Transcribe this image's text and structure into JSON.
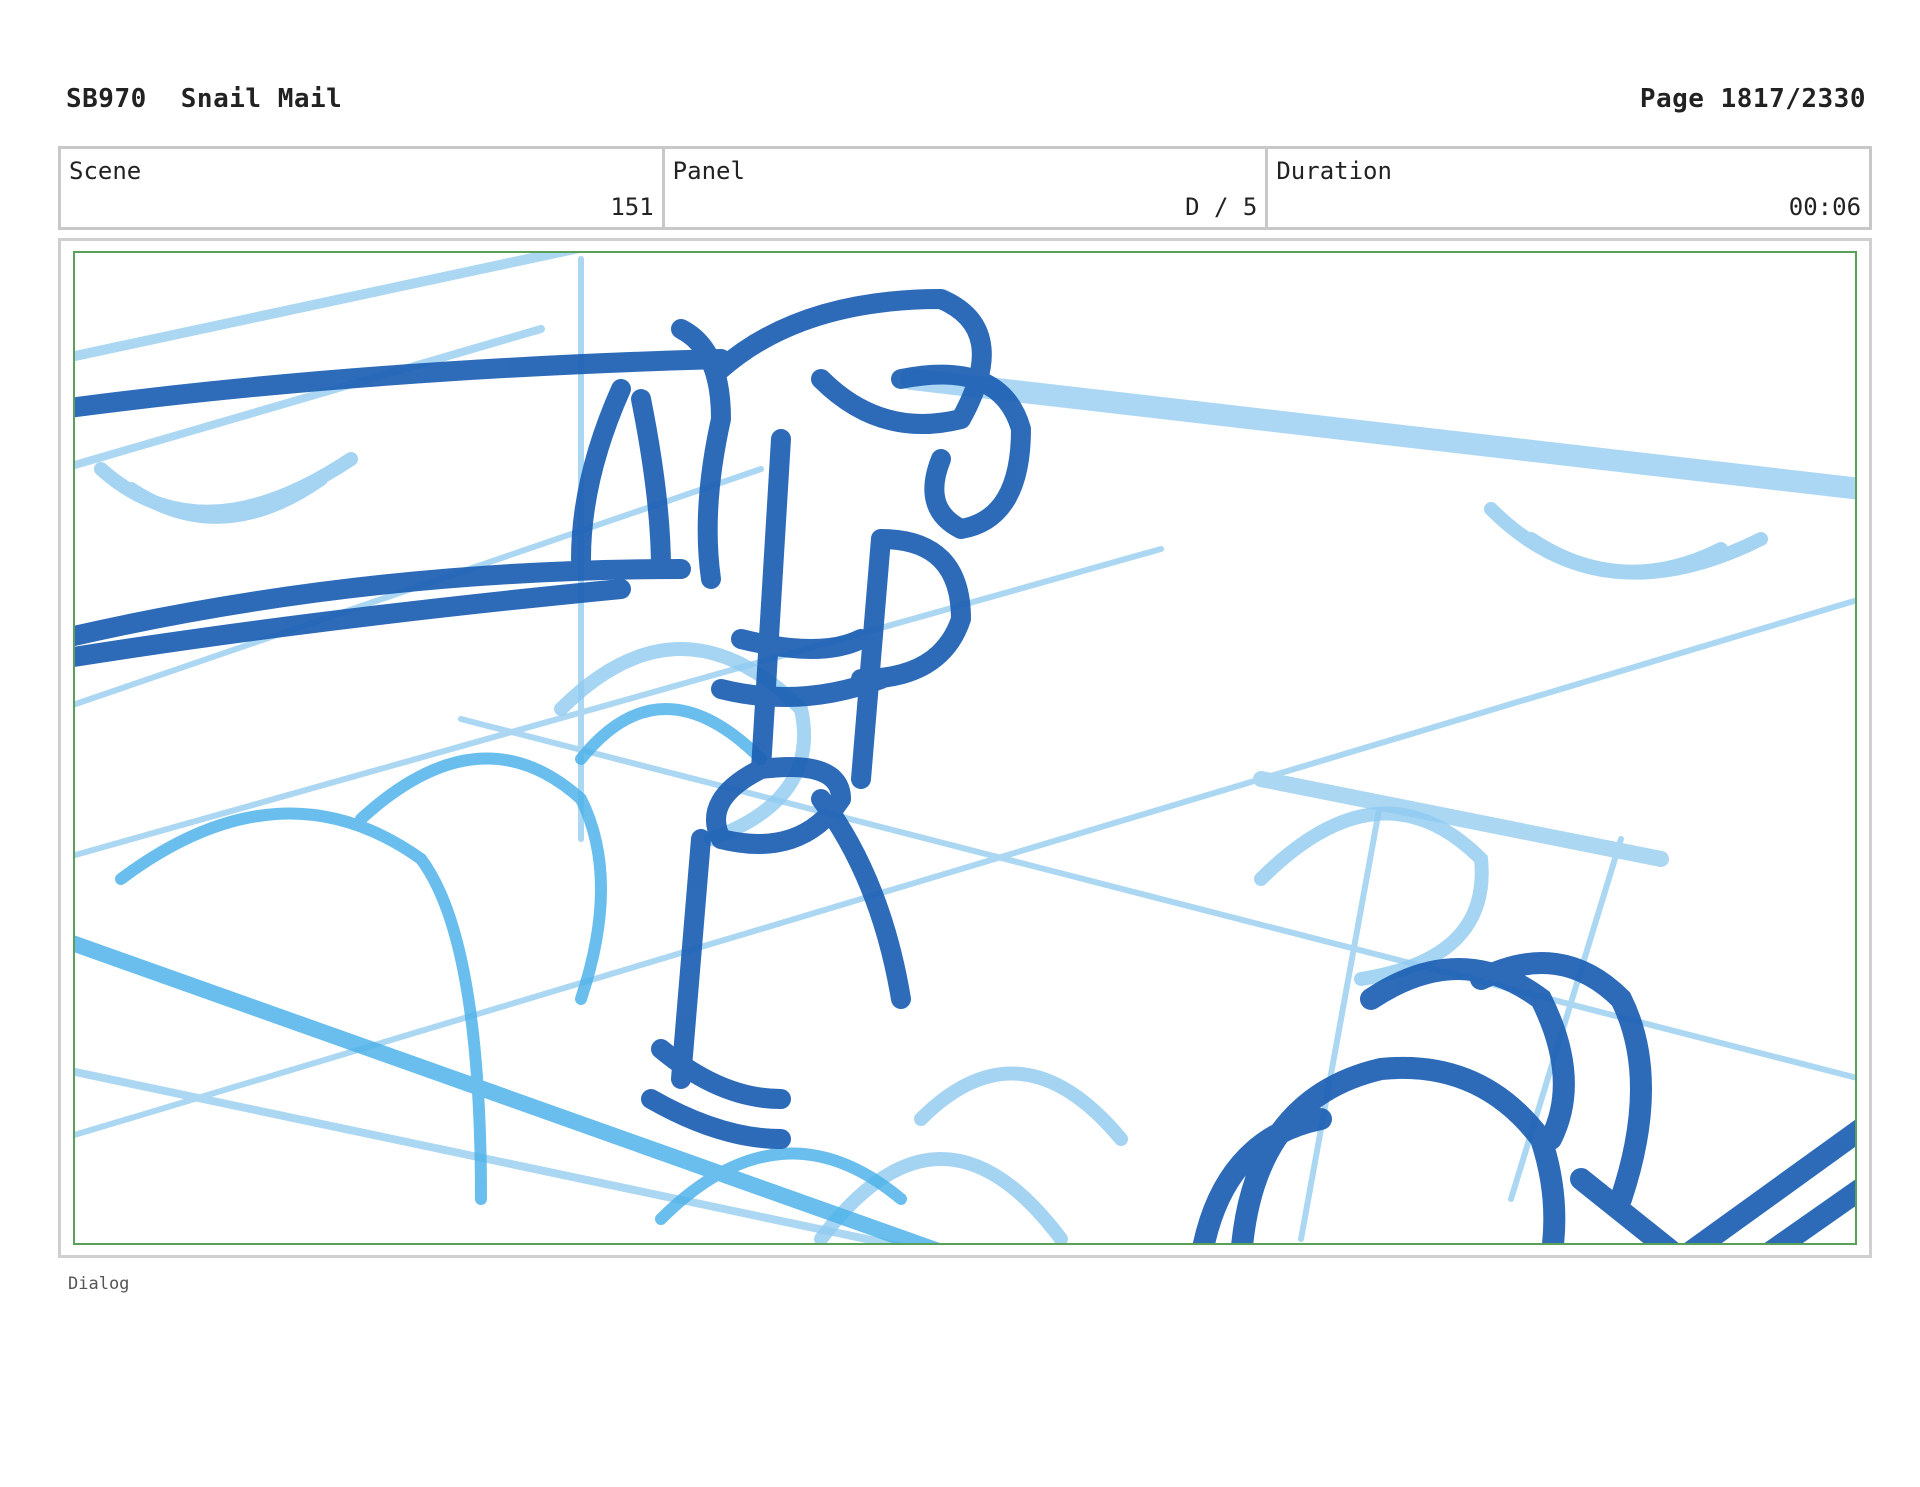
{
  "header": {
    "code": "SB970",
    "title": "Snail Mail",
    "page": "Page 1817/2330"
  },
  "info": {
    "scene_label": "Scene",
    "scene_value": "151",
    "panel_label": "Panel",
    "panel_value": "D / 5",
    "duration_label": "Duration",
    "duration_value": "00:06"
  },
  "sketch": {
    "line_color_dark": "#1c5fb4",
    "line_color_light": "#8fcaf0",
    "line_color_mid": "#4fb3ea",
    "frame_color": "#5aa05a"
  },
  "footer": {
    "dialog_label": "Dialog"
  }
}
